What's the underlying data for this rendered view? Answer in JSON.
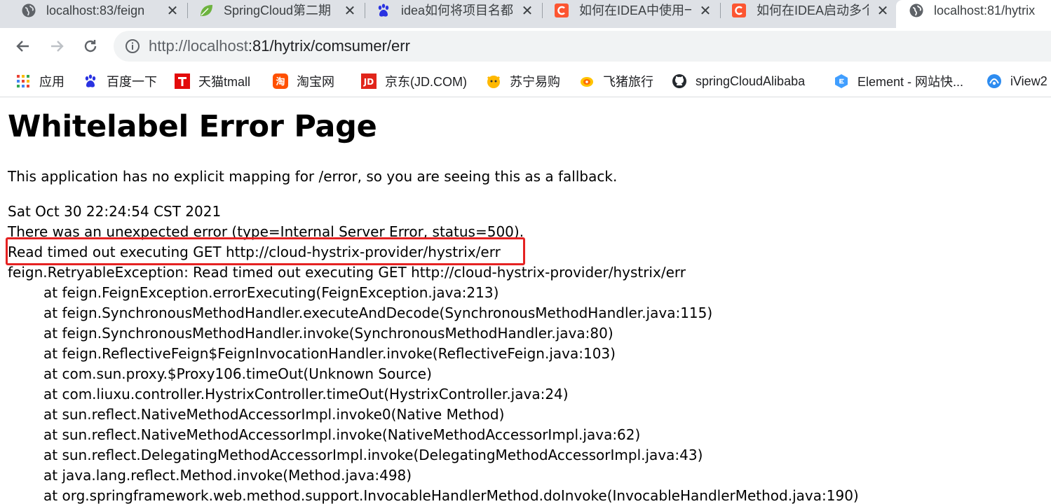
{
  "tabs": [
    {
      "title": "localhost:83/feign",
      "favicon": "globe-icon",
      "active": false
    },
    {
      "title": "SpringCloud第二期",
      "favicon": "spring-leaf-icon",
      "active": false
    },
    {
      "title": "idea如何将项目名都",
      "favicon": "baidu-paw-icon",
      "active": false
    },
    {
      "title": "如何在IDEA中使用一",
      "favicon": "csdn-c-icon",
      "active": false
    },
    {
      "title": "如何在IDEA启动多个",
      "favicon": "csdn-c-icon",
      "active": false
    },
    {
      "title": "localhost:81/hytrix",
      "favicon": "globe-icon",
      "active": true
    }
  ],
  "toolbar": {
    "url_host": "http://localhost",
    "url_rest": ":81/hytrix/comsumer/err"
  },
  "bookmarks": [
    {
      "label": "应用",
      "icon": "apps-grid-icon"
    },
    {
      "label": "百度一下",
      "icon": "baidu-paw-icon"
    },
    {
      "label": "天猫tmall",
      "icon": "tmall-icon"
    },
    {
      "label": "淘宝网",
      "icon": "taobao-icon"
    },
    {
      "label": "京东(JD.COM)",
      "icon": "jd-icon"
    },
    {
      "label": "苏宁易购",
      "icon": "suning-icon"
    },
    {
      "label": "飞猪旅行",
      "icon": "fliggy-icon"
    },
    {
      "label": "springCloudAlibaba",
      "icon": "github-icon"
    },
    {
      "label": "Element - 网站快...",
      "icon": "element-icon"
    },
    {
      "label": "iView2",
      "icon": "iview-icon"
    }
  ],
  "page": {
    "heading": "Whitelabel Error Page",
    "message": "This application has no explicit mapping for /error, so you are seeing this as a fallback.",
    "timestamp": "Sat Oct 30 22:24:54 CST 2021",
    "error_summary": "There was an unexpected error (type=Internal Server Error, status=500).",
    "error_message": "Read timed out executing GET http://cloud-hystrix-provider/hystrix/err",
    "exception": "feign.RetryableException: Read timed out executing GET http://cloud-hystrix-provider/hystrix/err",
    "stack_trace": [
      "at feign.FeignException.errorExecuting(FeignException.java:213)",
      "at feign.SynchronousMethodHandler.executeAndDecode(SynchronousMethodHandler.java:115)",
      "at feign.SynchronousMethodHandler.invoke(SynchronousMethodHandler.java:80)",
      "at feign.ReflectiveFeign$FeignInvocationHandler.invoke(ReflectiveFeign.java:103)",
      "at com.sun.proxy.$Proxy106.timeOut(Unknown Source)",
      "at com.liuxu.controller.HystrixController.timeOut(HystrixController.java:24)",
      "at sun.reflect.NativeMethodAccessorImpl.invoke0(Native Method)",
      "at sun.reflect.NativeMethodAccessorImpl.invoke(NativeMethodAccessorImpl.java:62)",
      "at sun.reflect.DelegatingMethodAccessorImpl.invoke(DelegatingMethodAccessorImpl.java:43)",
      "at java.lang.reflect.Method.invoke(Method.java:498)",
      "at org.springframework.web.method.support.InvocableHandlerMethod.doInvoke(InvocableHandlerMethod.java:190)"
    ]
  },
  "colors": {
    "highlight": "#e52222",
    "tab_strip": "#dee1e6",
    "omnibox": "#f1f3f4"
  }
}
